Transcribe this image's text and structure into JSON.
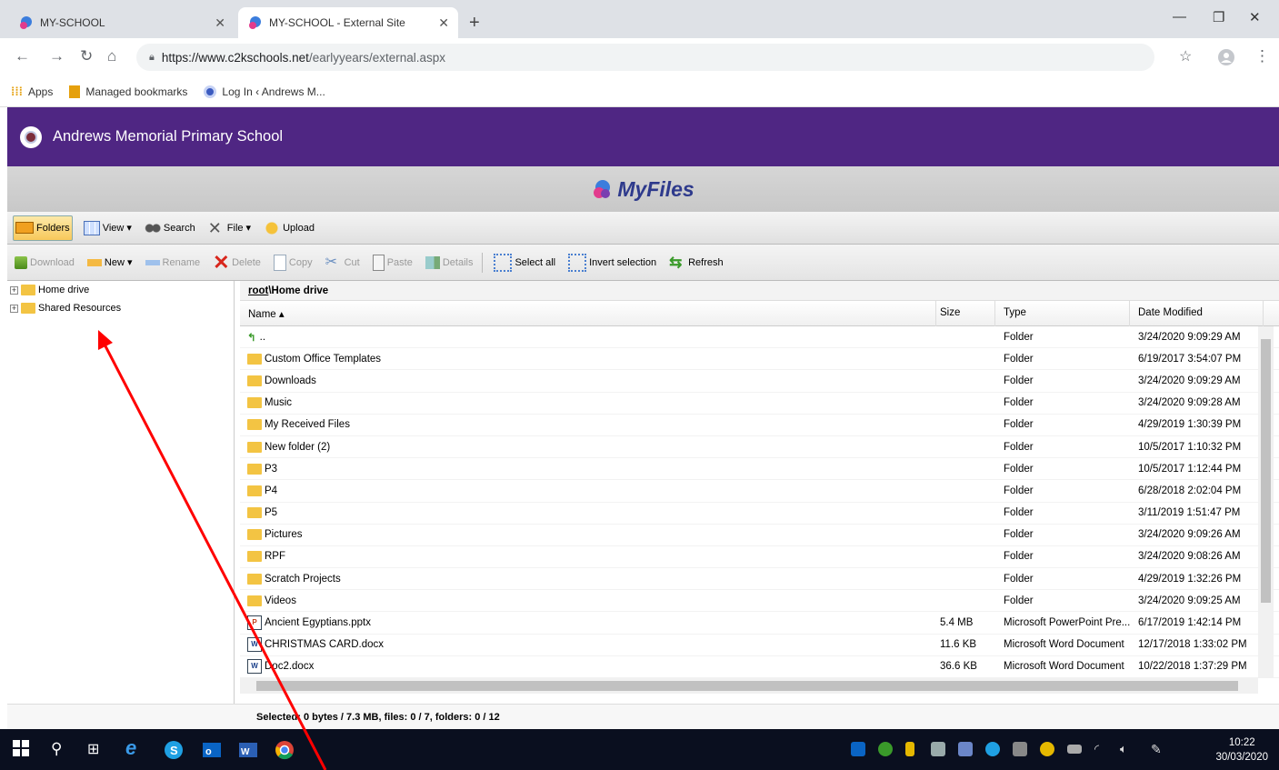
{
  "browser": {
    "tabs": [
      {
        "title": "MY-SCHOOL",
        "active": false
      },
      {
        "title": "MY-SCHOOL - External Site",
        "active": true
      }
    ],
    "url_host": "https://www.c2kschools.net",
    "url_path": "/earlyyears/external.aspx",
    "bookmarks": [
      "Apps",
      "Managed bookmarks",
      "Log In ‹ Andrews M..."
    ]
  },
  "header": {
    "school_name": "Andrews Memorial Primary School",
    "brand_color": "#4f2683"
  },
  "myfiles": {
    "title": "MyFiles"
  },
  "toolbar1": {
    "folders": "Folders",
    "view": "View ▾",
    "search": "Search",
    "file": "File ▾",
    "upload": "Upload"
  },
  "toolbar2": {
    "download": "Download",
    "new": "New ▾",
    "rename": "Rename",
    "delete": "Delete",
    "copy": "Copy",
    "cut": "Cut",
    "paste": "Paste",
    "details": "Details",
    "select_all": "Select all",
    "invert_selection": "Invert selection",
    "refresh": "Refresh"
  },
  "tree": {
    "items": [
      "Home drive",
      "Shared Resources"
    ]
  },
  "grid": {
    "path_root": "root",
    "path_rest": "\\Home drive",
    "columns": {
      "name": "Name ▴",
      "size": "Size",
      "type": "Type",
      "date": "Date Modified"
    },
    "rows": [
      {
        "name": "..",
        "size": "",
        "type": "Folder",
        "date": "3/24/2020 9:09:29 AM",
        "icon": "up-icon"
      },
      {
        "name": "Custom Office Templates",
        "size": "",
        "type": "Folder",
        "date": "6/19/2017 3:54:07 PM",
        "icon": "folder-icon"
      },
      {
        "name": "Downloads",
        "size": "",
        "type": "Folder",
        "date": "3/24/2020 9:09:29 AM",
        "icon": "folder-icon"
      },
      {
        "name": "Music",
        "size": "",
        "type": "Folder",
        "date": "3/24/2020 9:09:28 AM",
        "icon": "folder-icon"
      },
      {
        "name": "My Received Files",
        "size": "",
        "type": "Folder",
        "date": "4/29/2019 1:30:39 PM",
        "icon": "folder-icon"
      },
      {
        "name": "New folder (2)",
        "size": "",
        "type": "Folder",
        "date": "10/5/2017 1:10:32 PM",
        "icon": "folder-icon"
      },
      {
        "name": "P3",
        "size": "",
        "type": "Folder",
        "date": "10/5/2017 1:12:44 PM",
        "icon": "folder-icon"
      },
      {
        "name": "P4",
        "size": "",
        "type": "Folder",
        "date": "6/28/2018 2:02:04 PM",
        "icon": "folder-icon"
      },
      {
        "name": "P5",
        "size": "",
        "type": "Folder",
        "date": "3/11/2019 1:51:47 PM",
        "icon": "folder-icon"
      },
      {
        "name": "Pictures",
        "size": "",
        "type": "Folder",
        "date": "3/24/2020 9:09:26 AM",
        "icon": "folder-icon"
      },
      {
        "name": "RPF",
        "size": "",
        "type": "Folder",
        "date": "3/24/2020 9:08:26 AM",
        "icon": "folder-icon"
      },
      {
        "name": "Scratch Projects",
        "size": "",
        "type": "Folder",
        "date": "4/29/2019 1:32:26 PM",
        "icon": "folder-icon"
      },
      {
        "name": "Videos",
        "size": "",
        "type": "Folder",
        "date": "3/24/2020 9:09:25 AM",
        "icon": "folder-icon"
      },
      {
        "name": "Ancient Egyptians.pptx",
        "size": "5.4 MB",
        "type": "Microsoft PowerPoint Pre...",
        "date": "6/17/2019 1:42:14 PM",
        "icon": "powerpoint-icon"
      },
      {
        "name": "CHRISTMAS CARD.docx",
        "size": "11.6 KB",
        "type": "Microsoft Word Document",
        "date": "12/17/2018 1:33:02 PM",
        "icon": "word-icon"
      },
      {
        "name": "Doc2.docx",
        "size": "36.6 KB",
        "type": "Microsoft Word Document",
        "date": "10/22/2018 1:37:29 PM",
        "icon": "word-icon"
      }
    ]
  },
  "status": "Selected: 0 bytes / 7.3 MB, files: 0 / 7, folders: 0 / 12",
  "taskbar": {
    "time": "10:22",
    "date": "30/03/2020"
  }
}
